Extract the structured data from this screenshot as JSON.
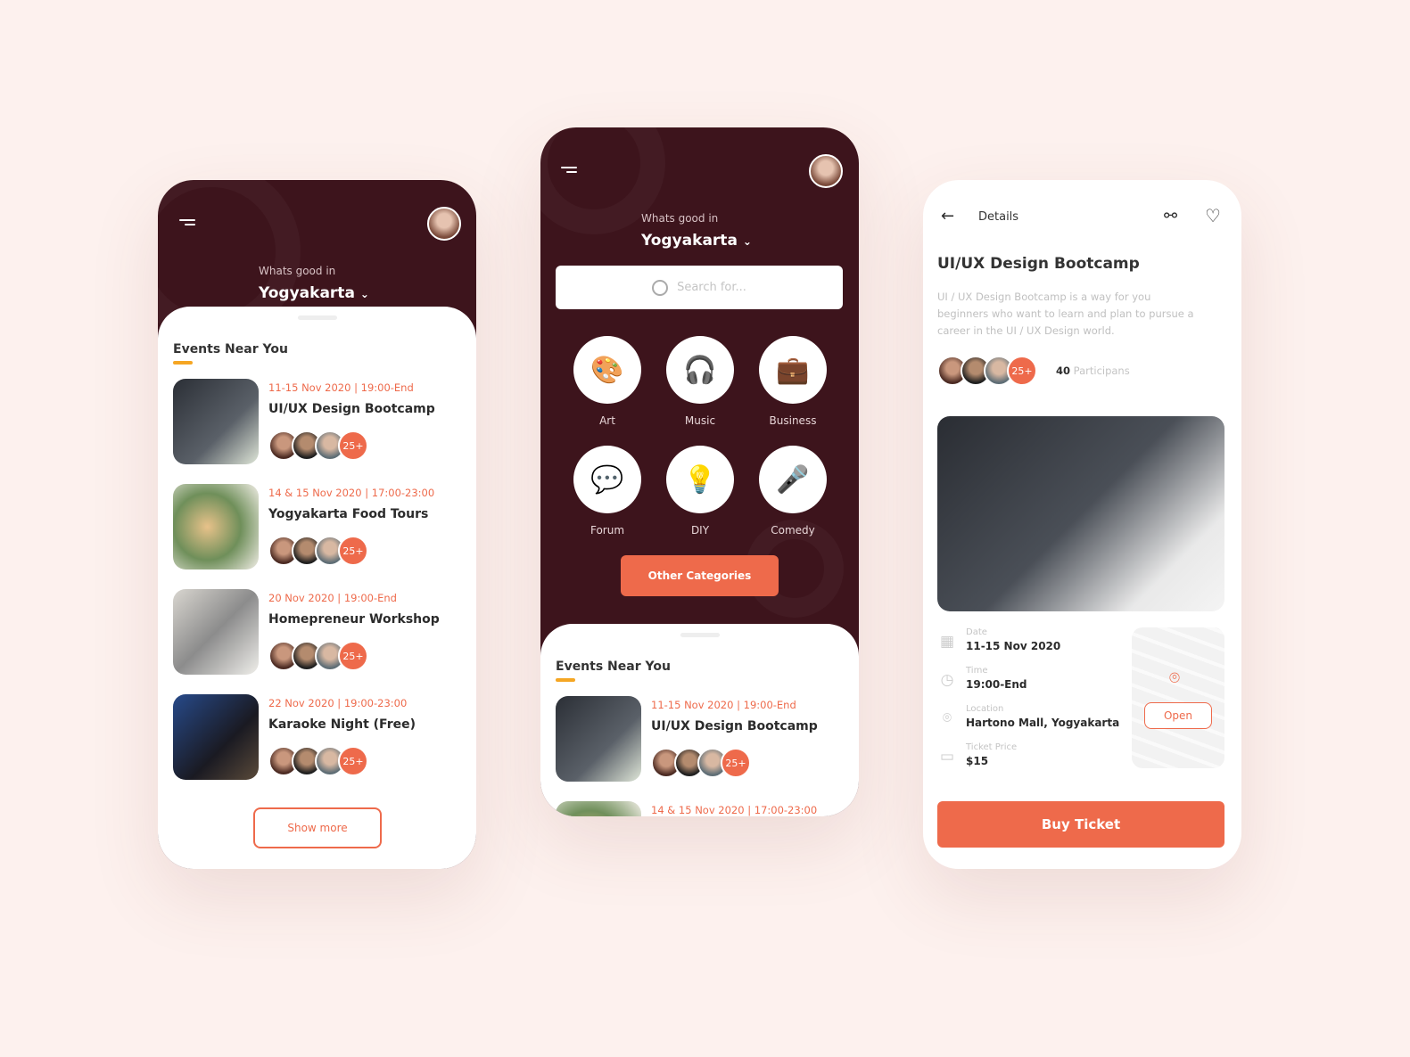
{
  "colors": {
    "background": "#fdf1ee",
    "dark": "#3d141c",
    "accent": "#ee6a4b",
    "underline": "#f5a623"
  },
  "header": {
    "subtitle": "Whats good in",
    "city": "Yogyakarta"
  },
  "search": {
    "placeholder": "Search for..."
  },
  "categories": [
    {
      "label": "Art",
      "icon": "palette-icon",
      "glyph": "🎨"
    },
    {
      "label": "Music",
      "icon": "headphones-icon",
      "glyph": "🎧"
    },
    {
      "label": "Business",
      "icon": "briefcase-icon",
      "glyph": "💼"
    },
    {
      "label": "Forum",
      "icon": "chat-icon",
      "glyph": "💬"
    },
    {
      "label": "DIY",
      "icon": "lightbulb-icon",
      "glyph": "💡"
    },
    {
      "label": "Comedy",
      "icon": "microphone-icon",
      "glyph": "🎤"
    }
  ],
  "other_categories": "Other Categories",
  "events_title": "Events Near You",
  "events": [
    {
      "date": "11-15 Nov 2020 | 19:00-End",
      "title": "UI/UX Design Bootcamp",
      "count": "25+"
    },
    {
      "date": "14 & 15 Nov 2020 | 17:00-23:00",
      "title": "Yogyakarta Food Tours",
      "count": "25+"
    },
    {
      "date": "20 Nov 2020 | 19:00-End",
      "title": "Homepreneur Workshop",
      "count": "25+"
    },
    {
      "date": "22 Nov 2020 | 19:00-23:00",
      "title": "Karaoke Night (Free)",
      "count": "25+"
    }
  ],
  "show_more": "Show more",
  "details": {
    "header": "Details",
    "title": "UI/UX Design Bootcamp",
    "description": "UI / UX Design Bootcamp is a way for you beginners who want to learn and plan to pursue a career in the UI / UX Design world.",
    "participants_count": "25+",
    "participants_number": "40",
    "participants_label": "Participans",
    "date_label": "Date",
    "date": "11-15 Nov 2020",
    "time_label": "Time",
    "time": "19:00-End",
    "location_label": "Location",
    "location": "Hartono Mall, Yogyakarta",
    "price_label": "Ticket Price",
    "price": "$15",
    "map_open": "Open",
    "buy": "Buy Ticket"
  }
}
